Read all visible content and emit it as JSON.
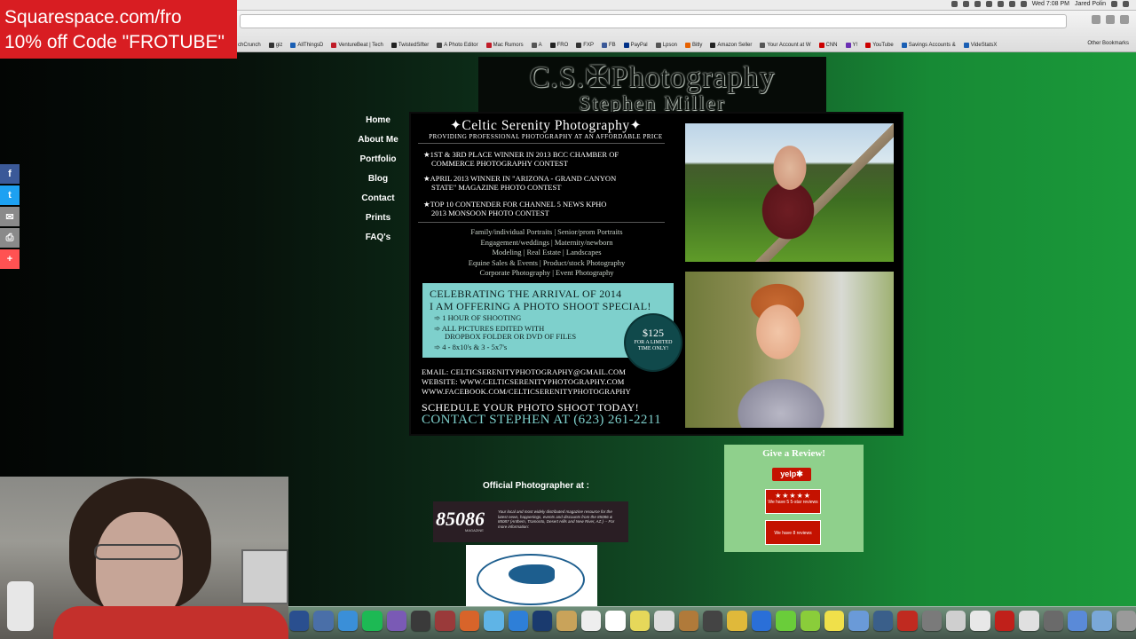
{
  "menubar": {
    "clock": "Wed 7:08 PM",
    "user": "Jared Polin"
  },
  "promo": {
    "line1": "Squarespace.com/fro",
    "line2": "10% off Code \"FROTUBE\""
  },
  "bookmarks": [
    {
      "label": "chCrunch",
      "color": "#2b8a3e"
    },
    {
      "label": "giz",
      "color": "#333333"
    },
    {
      "label": "AllThingsD",
      "color": "#1a5fb4"
    },
    {
      "label": "VentureBeat | Tech",
      "color": "#c01c28"
    },
    {
      "label": "TwistedSifter",
      "color": "#222222"
    },
    {
      "label": "A Photo Editor",
      "color": "#444444"
    },
    {
      "label": "Mac Rumors",
      "color": "#c01c28"
    },
    {
      "label": "A",
      "color": "#555555"
    },
    {
      "label": "FRO",
      "color": "#222222"
    },
    {
      "label": "FXP",
      "color": "#333333"
    },
    {
      "label": "FB",
      "color": "#3b5998"
    },
    {
      "label": "PayPal",
      "color": "#003087"
    },
    {
      "label": "Lpson",
      "color": "#555555"
    },
    {
      "label": "Bitly",
      "color": "#e66100"
    },
    {
      "label": "Amazon Seller",
      "color": "#222222"
    },
    {
      "label": "Your Account at W",
      "color": "#555555"
    },
    {
      "label": "CNN",
      "color": "#cc0000"
    },
    {
      "label": "Y!",
      "color": "#6b2fb3"
    },
    {
      "label": "YouTube",
      "color": "#cc0000"
    },
    {
      "label": "Savings Accounts &",
      "color": "#1a5fb4"
    },
    {
      "label": "VideStatsX",
      "color": "#1a5fb4"
    }
  ],
  "other_bookmarks": "Other Bookmarks",
  "share": [
    {
      "icon": "facebook-icon",
      "glyph": "f",
      "color": "#3b5998"
    },
    {
      "icon": "twitter-icon",
      "glyph": "t",
      "color": "#1da1f2"
    },
    {
      "icon": "email-icon",
      "glyph": "✉",
      "color": "#8a8a8a"
    },
    {
      "icon": "print-icon",
      "glyph": "⎙",
      "color": "#8a8a8a"
    },
    {
      "icon": "plus-icon",
      "glyph": "+",
      "color": "#ff5252"
    }
  ],
  "site": {
    "logo_line1": "C.S.✠Photography",
    "logo_line2": "Stephen Miller"
  },
  "nav": [
    "Home",
    "About Me",
    "Portfolio",
    "Blog",
    "Contact",
    "Prints",
    "FAQ's"
  ],
  "flyer": {
    "title": "✦Celtic Serenity Photography✦",
    "subtitle": "PROVIDING PROFESSIONAL PHOTOGRAPHY AT AN AFFORDABLE PRICE",
    "awards": [
      [
        "★1ST & 3RD PLACE WINNER IN 2013 BCC CHAMBER OF",
        "COMMERCE PHOTOGRAPHY CONTEST"
      ],
      [
        "★APRIL 2013 WINNER IN \"ARIZONA - GRAND CANYON",
        "STATE\" MAGAZINE PHOTO CONTEST"
      ],
      [
        "★TOP 10 CONTENDER FOR CHANNEL 5 NEWS KPHO",
        "2013 MONSOON PHOTO CONTEST"
      ]
    ],
    "services": [
      "Family/individual Portraits  |  Senior/prom Portraits",
      "Engagement/weddings  |  Maternity/newborn",
      "Modeling  |  Real Estate  |  Landscapes",
      "Equine Sales & Events  |  Product/stock Photography",
      "Corporate Photography  |  Event Photography"
    ],
    "special": {
      "heading1": "CELEBRATING THE ARRIVAL OF 2014",
      "heading2": "I AM OFFERING A PHOTO SHOOT SPECIAL!",
      "items": [
        "➾ 1 HOUR OF SHOOTING",
        "➾ ALL PICTURES EDITED WITH",
        "DROPBOX FOLDER OR DVD OF FILES",
        "➾ 4 - 8x10's & 3 - 5x7's"
      ]
    },
    "price": {
      "amount": "$125",
      "note1": "FOR A LIMITED",
      "note2": "TIME ONLY!"
    },
    "contact": [
      "EMAIL: CELTICSERENITYPHOTOGRAPHY@GMAIL.COM",
      "WEBSITE: WWW.CELTICSERENITYPHOTOGRAPHY.COM",
      "WWW.FACEBOOK.COM/CELTICSERENITYPHOTOGRAPHY"
    ],
    "cta1": "SCHEDULE YOUR PHOTO SHOOT TODAY!",
    "cta2": "CONTACT STEPHEN AT (623) 261-2211"
  },
  "official": {
    "label": "Official Photographer at :",
    "mag_name": "85086",
    "mag_sub": "MAGAZINE",
    "mag_text": "Your local and most widely distributed magazine resource for the latest news, happenings, events and discounts from the 85086 & 85087 (Anthem, Tramonto, Desert Hills and New River, AZ.) -- For more information:"
  },
  "review": {
    "title": "Give a Review!",
    "yelp": "yelp✱",
    "badge1_stars": "★★★★★",
    "badge1_text": "We have 5 5-star reviews",
    "badge2_text": "We have 8 reviews"
  },
  "dock": [
    "#2a4f8f",
    "#4a6fa8",
    "#3a8fd8",
    "#1db954",
    "#7a5ab5",
    "#3a3a3a",
    "#9a3a3a",
    "#d8642a",
    "#5fb4e6",
    "#2e7fd8",
    "#1a3a6e",
    "#c9a35a",
    "#eeeeee",
    "#ffffff",
    "#e6d85a",
    "#dddddd",
    "#b07a3a",
    "#444444",
    "#e0b93a",
    "#2a6fd8",
    "#6acd3a",
    "#8acd3a",
    "#f0e04a",
    "#6a9ad8",
    "#3a5f8a",
    "#c02a20",
    "#7a7a7a",
    "#cfcfcf",
    "#e8e8e8",
    "#c0201a",
    "#e0e0e0",
    "#6a6a6a",
    "#5a8ad8",
    "#7aa8d8",
    "#9a9a9a"
  ]
}
